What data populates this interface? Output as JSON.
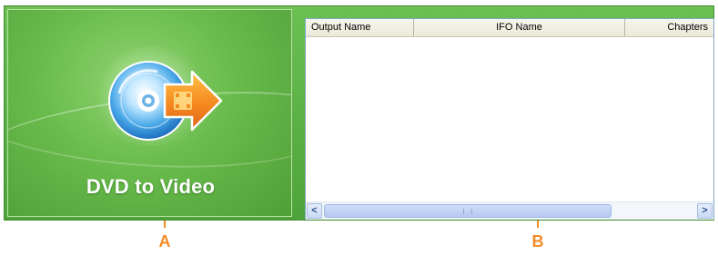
{
  "brand_panel": {
    "title": "DVD to Video",
    "icon": "dvd-disc-arrow-icon",
    "colors": {
      "panel_green": "#69bb4c",
      "arrow_orange": "#f58a1f"
    }
  },
  "list": {
    "columns": [
      {
        "label": "Output Name"
      },
      {
        "label": "IFO Name"
      },
      {
        "label": "Chapters"
      }
    ],
    "rows": [],
    "scrollbar": {
      "left_arrow": "<",
      "right_arrow": ">"
    }
  },
  "annotations": {
    "a": "A",
    "b": "B",
    "color": "#f28c28"
  }
}
